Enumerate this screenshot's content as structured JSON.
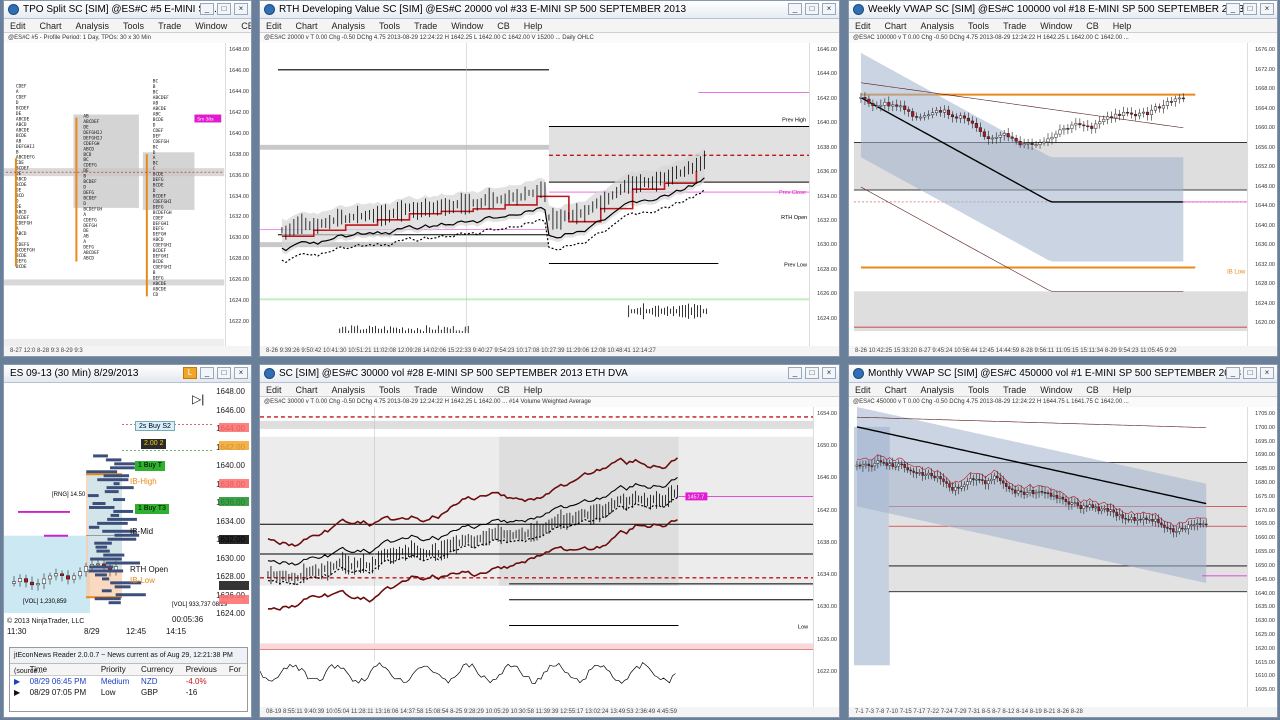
{
  "menus": [
    "Edit",
    "Chart",
    "Analysis",
    "Tools",
    "Trade",
    "Window",
    "CB",
    "Help"
  ],
  "windows": {
    "tpo": {
      "title": "TPO Split   SC [SIM] @ES#C  #5   E-MINI SP ...",
      "info": "@ES#C #5 - Profile Period: 1 Day, TPOs: 30 x 30 Min",
      "prices": [
        "1648.00",
        "1646.00",
        "1644.00",
        "1642.00",
        "1640.00",
        "1638.00",
        "1636.00",
        "1634.00",
        "1632.00",
        "1630.00",
        "1628.00",
        "1626.00",
        "1624.00",
        "1622.00"
      ],
      "badge": "5m 38s",
      "time": "8-27 12:0                    8-28 9:3                              8-29 9:3"
    },
    "rth": {
      "title": "RTH Developing Value   SC [SIM] @ES#C  20000 vol  #33   E-MINI SP 500 SEPTEMBER 2013",
      "info": "@ES#C 20000 v  T 0.00  Chg -0.50  DChg 4.75  2013-08-29 12:24:22  H 1642.25  L 1642.00  C 1642.00  V 15200  ...  Daily OHLC",
      "labels": [
        "Prev High",
        "Prev Close",
        "RTH Open",
        "Prev Low"
      ],
      "prices": [
        "1646.00",
        "1644.00",
        "1642.00",
        "1640.00",
        "1638.00",
        "1636.00",
        "1634.00",
        "1632.00",
        "1630.00",
        "1628.00",
        "1626.00",
        "1624.00"
      ],
      "osc": [
        "210000",
        "180000",
        "150000",
        "-150000",
        "-180000"
      ],
      "time": "8-26   9:39:26   9:50:42   10:41:30   10:51:21   11:02:08   12:09:28   14:02:06   15:22:33          9:40:27   9:54:23   10:17:08   10:27:39   11:29:06   12:08   10:48:41   12:14:27"
    },
    "weekly": {
      "title": "Weekly VWAP   SC [SIM] @ES#C  100000 vol  #18   E-MINI SP 500 SEPTEMBER 2013",
      "info": "@ES#C 100000 v  T 0.00  Chg -0.50  DChg 4.75  2013-08-29 12:24:22  H 1642.25  L 1642.00  C 1642.00  ...",
      "prices": [
        "1676.00",
        "1672.00",
        "1668.00",
        "1664.00",
        "1660.00",
        "1656.00",
        "1652.00",
        "1648.00",
        "1644.00",
        "1640.00",
        "1636.00",
        "1632.00",
        "1628.00",
        "1624.00",
        "1620.00"
      ],
      "ib_label": "IB Low",
      "time": "8-26   10:42:25   15:33:20   8-27   9:45:24   10:56:44   12:45   14:44:59   8-28   9:56:11   11:05:15   15:11:34   8-29   9:54:23   11:05:45   9:29"
    },
    "ninja": {
      "title": "ES 09-13 (30 Min)  8/29/2013",
      "orders": [
        {
          "label": "2s  Buy S2",
          "price": "1646.00"
        },
        {
          "label": "2.00  2",
          "price": "1644.00"
        },
        {
          "label": "1  Buy T",
          "price": "1642.00"
        },
        {
          "label": "1  Buy T3",
          "price": "1636.50"
        }
      ],
      "levels": [
        "IB-High",
        "IB-Mid",
        "RTH Open",
        "IB-Low"
      ],
      "prices": [
        "1648.00",
        "1646.00",
        "1644.00",
        "1642.00",
        "1640.00",
        "1638.00",
        "1636.00",
        "1634.00",
        "1632.00",
        "1630.00",
        "1628.00",
        "1626.00",
        "1624.00"
      ],
      "ticks": [
        "11:30",
        "8/29",
        "12:45",
        "14:15"
      ],
      "vol1": "[VOL] 933,737  08/29",
      "vol2": "[VOL] 1,230,859",
      "rng": "[RNG] 14.50",
      "timer": "00:05:36",
      "copyright": "© 2013 NinjaTrader, LLC"
    },
    "news": {
      "header": "jtEconNews Reader 2.0.0.7  ~ News current as of Aug 29, 12:21:38 PM  (source...",
      "columns": [
        "Time",
        "Priority",
        "Currency",
        "Previous",
        "For"
      ],
      "rows": [
        {
          "time": "08/29 06:45 PM",
          "priority": "Medium",
          "currency": "NZD",
          "previous": "-4.0%"
        },
        {
          "time": "08/29 07:05 PM",
          "priority": "Low",
          "currency": "GBP",
          "previous": "-16"
        }
      ]
    },
    "eth": {
      "title": "SC [SIM] @ES#C  30000 vol  #28   E-MINI SP 500 SEPTEMBER 2013  ETH DVA",
      "info": "@ES#C 30000 v  T 0.00  Chg -0.50  DChg 4.75  2013-08-29 12:24:22  H 1642.25  L 1642.00  ...  #14  Volume Weighted Average",
      "prices": [
        "1654.00",
        "1650.00",
        "1646.00",
        "1642.00",
        "1638.00",
        "1634.00",
        "1630.00",
        "1626.00",
        "1622.00"
      ],
      "label": "Low",
      "badge": "1457.7",
      "time": "08-19   8:55:11   9:40:39   10:05:04   11:28:11   13:16:06   14:37:58   15:08:54   8-25   9:28:29   10:05:29   10:30:58   11:39:39   12:55:17   13:02:24   13:49:53   2:36:49   4:45:59"
    },
    "monthly": {
      "title": "Monthly VWAP   SC [SIM] @ES#C  450000 vol  #1   E-MINI SP 500 SEPTEMBER 2013",
      "info": "@ES#C 450000 v  T 0.00  Chg -0.50  DChg 4.75  2013-08-29 12:24:22  H 1644.75  L 1641.75  C 1642.00  ...",
      "prices": [
        "1705.00",
        "1700.00",
        "1695.00",
        "1690.00",
        "1685.00",
        "1680.00",
        "1675.00",
        "1670.00",
        "1665.00",
        "1660.00",
        "1655.00",
        "1650.00",
        "1645.00",
        "1640.00",
        "1635.00",
        "1630.00",
        "1625.00",
        "1620.00",
        "1615.00",
        "1610.00",
        "1605.00"
      ],
      "time": "7-1   7-3   7-8   7-10   7-15   7-17   7-22   7-24   7-29   7-31   8-5   8-7   8-12   8-14   8-19   8-21   8-26   8-28"
    }
  },
  "colors": {
    "red": "#c0161b",
    "candle_red": "#b5121b",
    "green": "#1d8f2a",
    "orange": "#e8891a",
    "magenta": "#e01bd0",
    "vwap_band": "#9fb0cc"
  }
}
